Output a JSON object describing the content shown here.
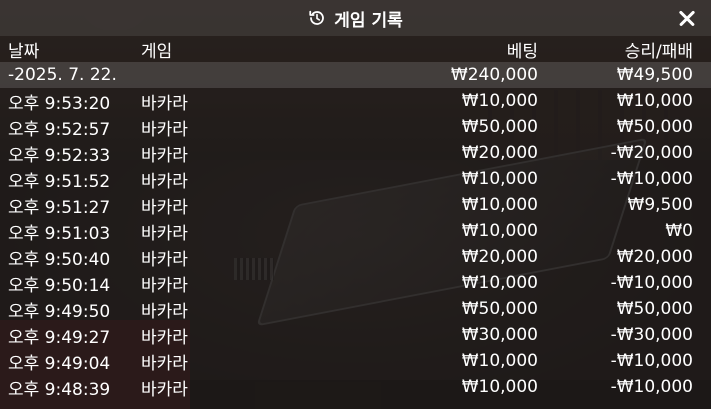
{
  "header": {
    "title": "게임 기록"
  },
  "columns": {
    "date": "날짜",
    "game": "게임",
    "bet": "베팅",
    "result": "승리/패배"
  },
  "summary": {
    "date": "-2025. 7. 22.",
    "bet": "₩240,000",
    "result": "₩49,500"
  },
  "rows": [
    {
      "time": "오후 9:53:20",
      "game": "바카라",
      "bet": "₩10,000",
      "result": "₩10,000"
    },
    {
      "time": "오후 9:52:57",
      "game": "바카라",
      "bet": "₩50,000",
      "result": "₩50,000"
    },
    {
      "time": "오후 9:52:33",
      "game": "바카라",
      "bet": "₩20,000",
      "result": "-₩20,000"
    },
    {
      "time": "오후 9:51:52",
      "game": "바카라",
      "bet": "₩10,000",
      "result": "-₩10,000"
    },
    {
      "time": "오후 9:51:27",
      "game": "바카라",
      "bet": "₩10,000",
      "result": "₩9,500"
    },
    {
      "time": "오후 9:51:03",
      "game": "바카라",
      "bet": "₩10,000",
      "result": "₩0"
    },
    {
      "time": "오후 9:50:40",
      "game": "바카라",
      "bet": "₩20,000",
      "result": "₩20,000"
    },
    {
      "time": "오후 9:50:14",
      "game": "바카라",
      "bet": "₩10,000",
      "result": "-₩10,000"
    },
    {
      "time": "오후 9:49:50",
      "game": "바카라",
      "bet": "₩50,000",
      "result": "₩50,000"
    },
    {
      "time": "오후 9:49:27",
      "game": "바카라",
      "bet": "₩30,000",
      "result": "-₩30,000"
    },
    {
      "time": "오후 9:49:04",
      "game": "바카라",
      "bet": "₩10,000",
      "result": "-₩10,000"
    },
    {
      "time": "오후 9:48:39",
      "game": "바카라",
      "bet": "₩10,000",
      "result": "-₩10,000"
    }
  ]
}
